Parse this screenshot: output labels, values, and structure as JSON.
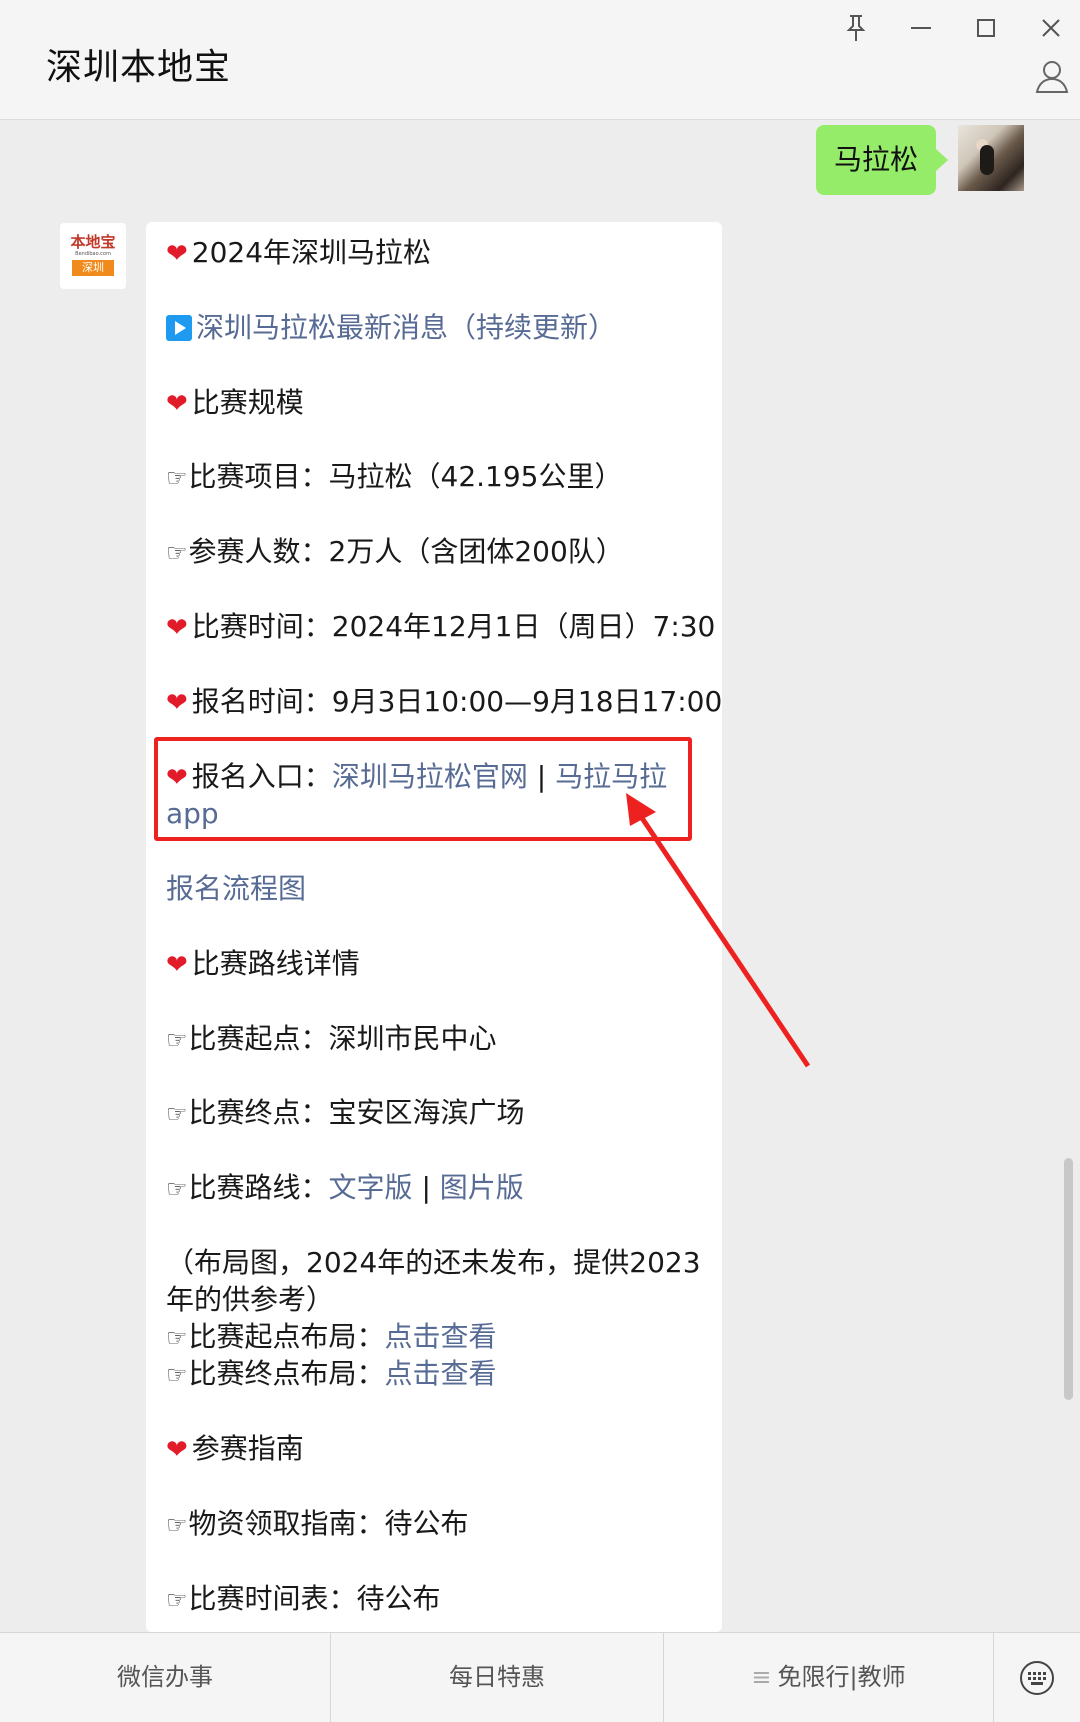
{
  "header": {
    "title": "深圳本地宝"
  },
  "logo": {
    "name": "本地宝",
    "site": "Bendibao.com",
    "city": "深圳"
  },
  "chat": {
    "user_message": "马拉松"
  },
  "article": {
    "lines": {
      "title": "2024年深圳马拉松",
      "news_link": "深圳马拉松最新消息（持续更新）",
      "scale_heading": "比赛规模",
      "event_item": "比赛项目：马拉松（42.195公里）",
      "participants": "参赛人数：2万人（含团体200队）",
      "race_time": "比赛时间：2024年12月1日（周日）7:30",
      "signup_time": "报名时间：9月3日10:00—9月18日17:00",
      "entry_label": "报名入口：",
      "entry_link1": "深圳马拉松官网",
      "entry_sep": " | ",
      "entry_link2": "马拉马拉",
      "entry_link2b": "app",
      "flow_link": "报名流程图",
      "route_heading": "比赛路线详情",
      "start": "比赛起点：深圳市民中心",
      "finish": "比赛终点：宝安区海滨广场",
      "route_label": "比赛路线：",
      "route_link1": "文字版",
      "route_sep": " | ",
      "route_link2": "图片版",
      "layout_note": "（布局图，2024年的还未发布，提供2023年的供参考）",
      "start_layout_label": "比赛起点布局：",
      "start_layout_link": "点击查看",
      "finish_layout_label": "比赛终点布局：",
      "finish_layout_link": "点击查看",
      "guide_heading": "参赛指南",
      "supplies": "物资领取指南：待公布",
      "schedule": "比赛时间表：待公布"
    }
  },
  "bottom_menu": {
    "item1": "微信办事",
    "item2": "每日特惠",
    "item3": "免限行|教师"
  },
  "colors": {
    "link": "#576b95",
    "bubble": "#95ec69",
    "highlight": "#ee2121"
  }
}
